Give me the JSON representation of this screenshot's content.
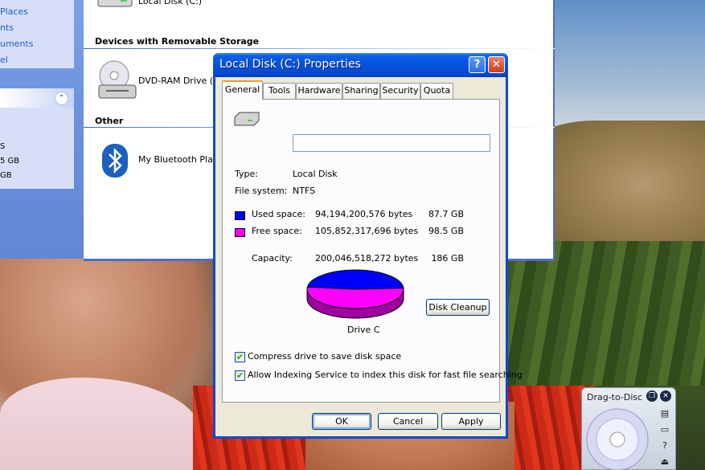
{
  "explorer": {
    "left_links": [
      "Places",
      "nts",
      "uments",
      "el"
    ],
    "left_details": [
      "S",
      "5 GB",
      "GB"
    ],
    "top_item_label": "Local Disk (C:)",
    "section_removable": "Devices with Removable Storage",
    "dvd_label": "DVD-RAM Drive (D:",
    "section_other": "Other",
    "bluetooth_label": "My Bluetooth Places"
  },
  "dialog": {
    "title": "Local Disk (C:) Properties",
    "help_glyph": "?",
    "close_glyph": "✕",
    "tabs": [
      "General",
      "Tools",
      "Hardware",
      "Sharing",
      "Security",
      "Quota"
    ],
    "active_tab": "General",
    "drive_name_value": "",
    "type_label": "Type:",
    "type_value": "Local Disk",
    "fs_label": "File system:",
    "fs_value": "NTFS",
    "used_label": "Used space:",
    "used_bytes": "94,194,200,576 bytes",
    "used_size": "87.7 GB",
    "free_label": "Free space:",
    "free_bytes": "105,852,317,696 bytes",
    "free_size": "98.5 GB",
    "capacity_label": "Capacity:",
    "capacity_bytes": "200,046,518,272 bytes",
    "capacity_size": "186 GB",
    "drive_caption": "Drive C",
    "disk_cleanup": "Disk Cleanup",
    "compress_label": "Compress drive to save disk space",
    "compress_checked": true,
    "index_label": "Allow Indexing Service to index this disk for fast file searching",
    "index_checked": true,
    "ok": "OK",
    "cancel": "Cancel",
    "apply": "Apply",
    "colors": {
      "used": "#0000ff",
      "free": "#ff00ff"
    },
    "used_fraction": 0.4709
  },
  "gadget": {
    "title": "Drag-to-Disc",
    "side_icons": [
      "list-icon",
      "folder-icon",
      "help-icon",
      "eject-icon"
    ],
    "help_glyph": "?"
  }
}
